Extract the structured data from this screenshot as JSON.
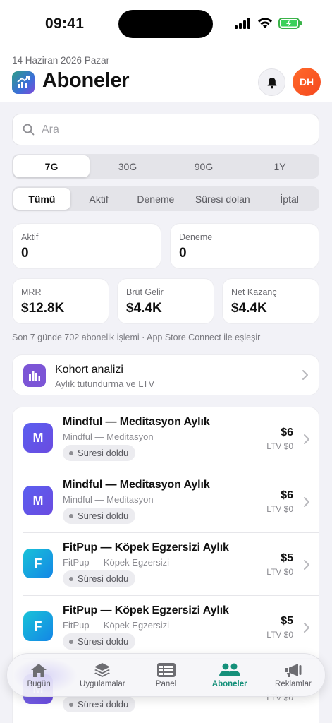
{
  "status_bar": {
    "time": "09:41"
  },
  "header": {
    "date": "14 Haziran 2026 Pazar",
    "title": "Aboneler",
    "avatar_initials": "DH"
  },
  "search": {
    "placeholder": "Ara",
    "value": ""
  },
  "range_segment": {
    "items": [
      "7G",
      "30G",
      "90G",
      "1Y"
    ],
    "selected": "7G"
  },
  "filter_segment": {
    "items": [
      "Tümü",
      "Aktif",
      "Deneme",
      "Süresi dolan",
      "İptal"
    ],
    "selected": "Tümü"
  },
  "stats": {
    "active": {
      "label": "Aktif",
      "value": "0"
    },
    "trial": {
      "label": "Deneme",
      "value": "0"
    },
    "mrr": {
      "label": "MRR",
      "value": "$12.8K"
    },
    "gross": {
      "label": "Brüt Gelir",
      "value": "$4.4K"
    },
    "net": {
      "label": "Net Kazanç",
      "value": "$4.4K"
    }
  },
  "footnote": "Son 7 günde 702 abonelik işlemi · App Store Connect ile eşleşir",
  "cohort": {
    "title": "Kohort analizi",
    "subtitle": "Aylık tutundurma ve LTV"
  },
  "subscriptions": [
    {
      "initial": "M",
      "title": "Mindful — Meditasyon Aylık",
      "app": "Mindful — Meditasyon",
      "status": "Süresi doldu",
      "price": "$6",
      "ltv": "LTV $0",
      "color": "#5b5ff0"
    },
    {
      "initial": "M",
      "title": "Mindful — Meditasyon Aylık",
      "app": "Mindful — Meditasyon",
      "status": "Süresi doldu",
      "price": "$6",
      "ltv": "LTV $0",
      "color": "#5b5ff0"
    },
    {
      "initial": "F",
      "title": "FitPup — Köpek Egzersizi Aylık",
      "app": "FitPup — Köpek Egzersizi",
      "status": "Süresi doldu",
      "price": "$5",
      "ltv": "LTV $0",
      "color": "#14a8e0"
    },
    {
      "initial": "F",
      "title": "FitPup — Köpek Egzersizi Aylık",
      "app": "FitPup — Köpek Egzersizi",
      "status": "Süresi doldu",
      "price": "$5",
      "ltv": "LTV $0",
      "color": "#14a8e0"
    },
    {
      "initial": "M",
      "title": "",
      "app": "",
      "status": "Süresi doldu",
      "price": "",
      "ltv": "LTV $0",
      "color": "#7a6ee8"
    }
  ],
  "tabbar": {
    "items": [
      "Bugün",
      "Uygulamalar",
      "Panel",
      "Aboneler",
      "Reklamlar"
    ],
    "active": "Aboneler",
    "accent": "#15907a"
  }
}
